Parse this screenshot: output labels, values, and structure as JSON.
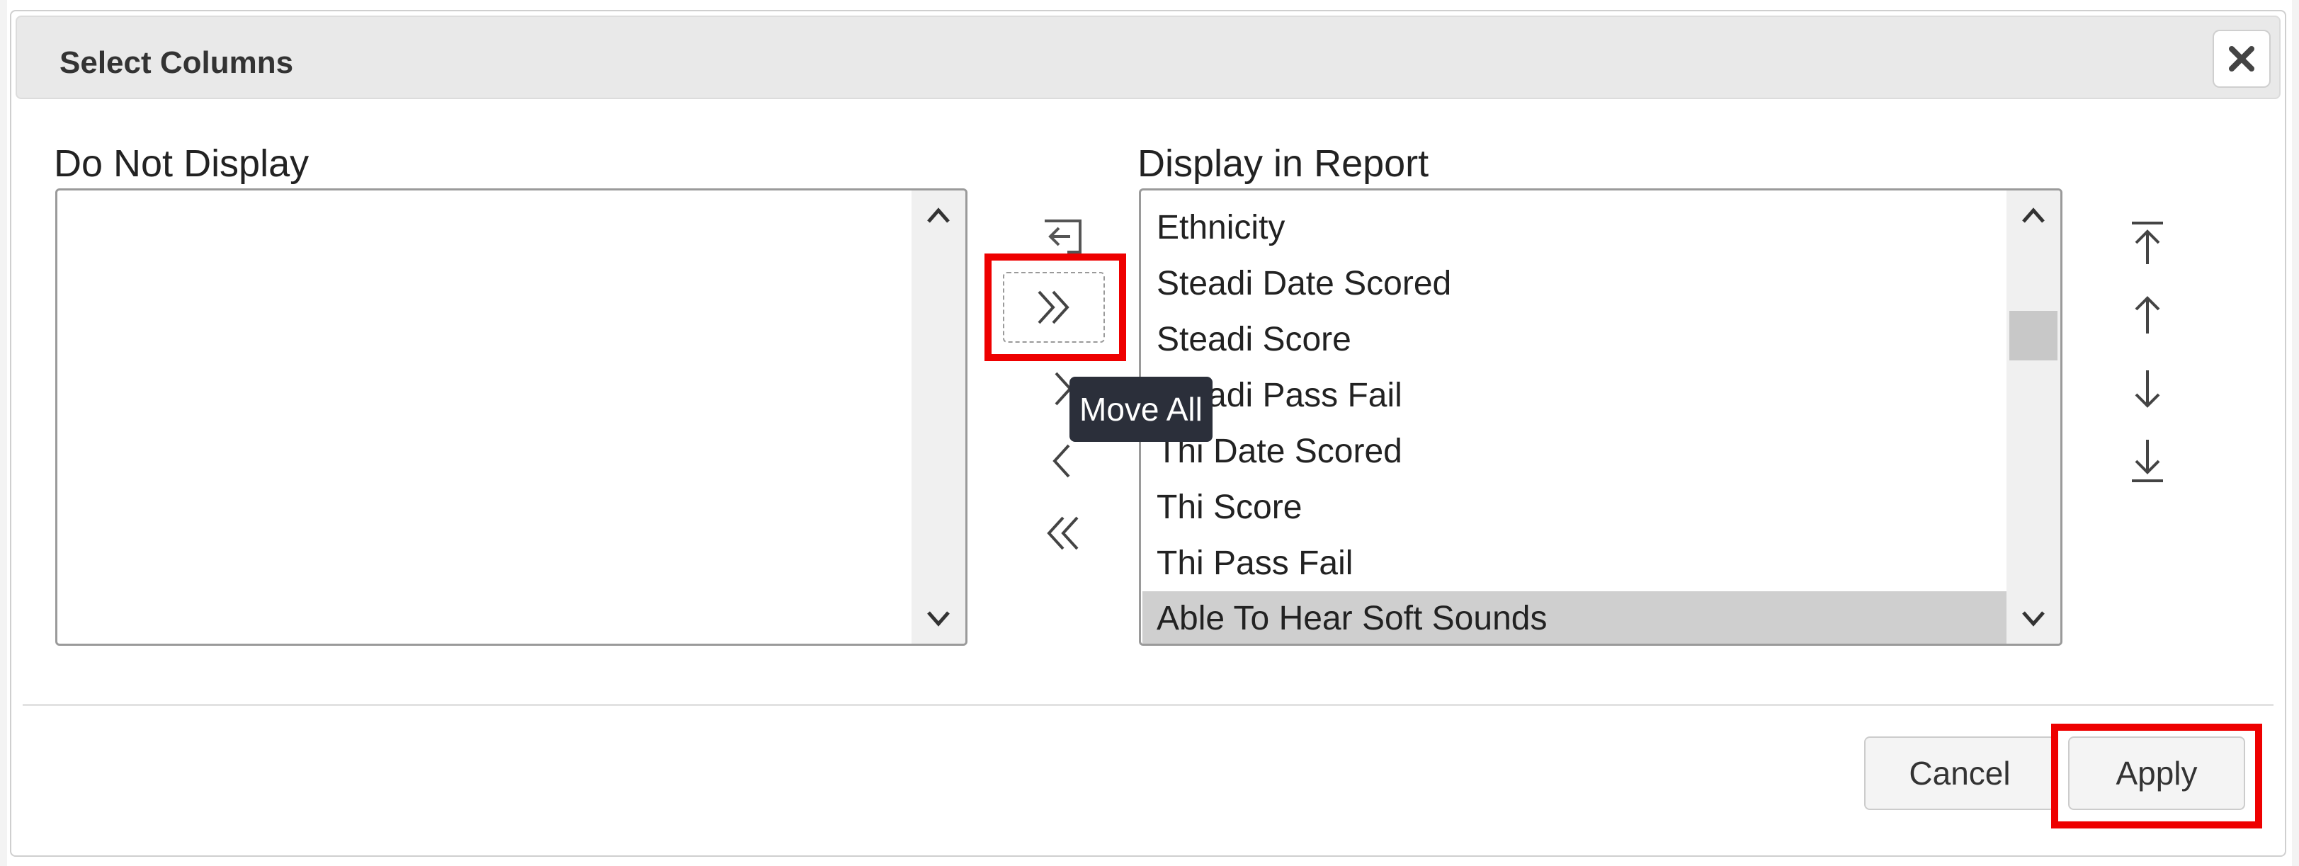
{
  "dialog": {
    "title": "Select Columns",
    "close_icon": "close-icon"
  },
  "left_list": {
    "label": "Do Not Display",
    "items": []
  },
  "right_list": {
    "label": "Display in Report",
    "items": [
      {
        "label": "Ethnicity"
      },
      {
        "label": "Steadi Date Scored"
      },
      {
        "label": "Steadi Score"
      },
      {
        "label": "Steadi Pass Fail"
      },
      {
        "label": "Thi Date Scored"
      },
      {
        "label": "Thi Score"
      },
      {
        "label": "Thi Pass Fail"
      },
      {
        "label": "Able To Hear Soft Sounds",
        "selected": true
      }
    ]
  },
  "move_controls": {
    "reset_icon": "reset-icon",
    "move_all_icon": "double-chevron-right-icon",
    "move_right_icon": "chevron-right-icon",
    "move_left_icon": "chevron-left-icon",
    "remove_all_icon": "double-chevron-left-icon",
    "tooltip": "Move All"
  },
  "sort_controls": {
    "top_icon": "move-to-top-icon",
    "up_icon": "arrow-up-icon",
    "down_icon": "arrow-down-icon",
    "bottom_icon": "move-to-bottom-icon"
  },
  "footer": {
    "cancel_label": "Cancel",
    "apply_label": "Apply"
  },
  "colors": {
    "highlight": "#ee0000",
    "tooltip_bg": "#2b2f3a",
    "selected_row": "#cfcfcf"
  }
}
